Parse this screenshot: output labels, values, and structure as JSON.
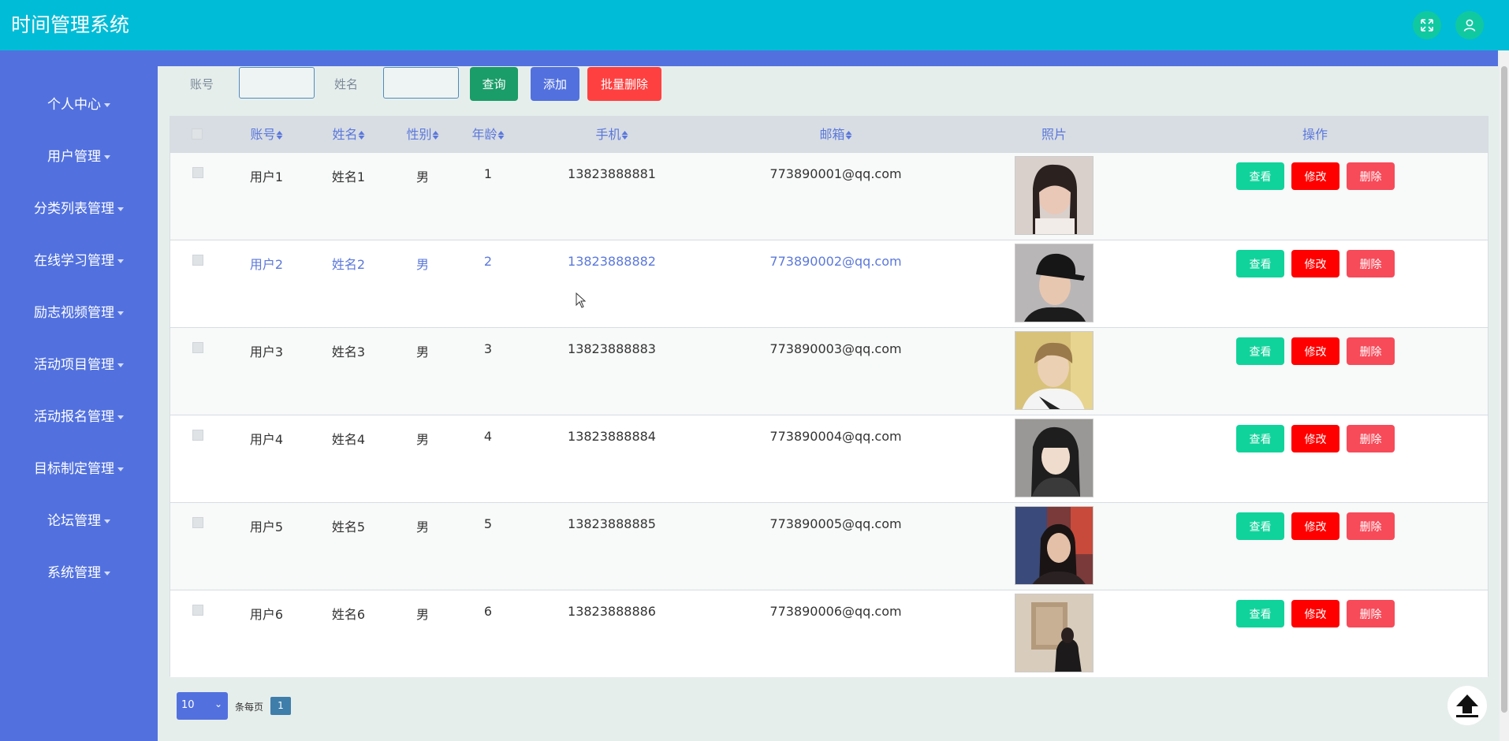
{
  "app": {
    "title": "时间管理系统"
  },
  "header": {
    "icons": [
      "fullscreen-icon",
      "user-icon"
    ]
  },
  "sidebar": {
    "items": [
      {
        "label": "个人中心"
      },
      {
        "label": "用户管理"
      },
      {
        "label": "分类列表管理"
      },
      {
        "label": "在线学习管理"
      },
      {
        "label": "励志视频管理"
      },
      {
        "label": "活动项目管理"
      },
      {
        "label": "活动报名管理"
      },
      {
        "label": "目标制定管理"
      },
      {
        "label": "论坛管理"
      },
      {
        "label": "系统管理"
      }
    ]
  },
  "search": {
    "account_label": "账号",
    "account_value": "",
    "name_label": "姓名",
    "name_value": "",
    "query_button": "查询",
    "add_button": "添加",
    "batch_delete_button": "批量删除"
  },
  "table": {
    "headers": [
      "账号",
      "姓名",
      "性别",
      "年龄",
      "手机",
      "邮箱",
      "照片",
      "操作"
    ],
    "rows": [
      {
        "account": "用户1",
        "name": "姓名1",
        "gender": "男",
        "age": "1",
        "phone": "13823888881",
        "email": "773890001@qq.com"
      },
      {
        "account": "用户2",
        "name": "姓名2",
        "gender": "男",
        "age": "2",
        "phone": "13823888882",
        "email": "773890002@qq.com"
      },
      {
        "account": "用户3",
        "name": "姓名3",
        "gender": "男",
        "age": "3",
        "phone": "13823888883",
        "email": "773890003@qq.com"
      },
      {
        "account": "用户4",
        "name": "姓名4",
        "gender": "男",
        "age": "4",
        "phone": "13823888884",
        "email": "773890004@qq.com"
      },
      {
        "account": "用户5",
        "name": "姓名5",
        "gender": "男",
        "age": "5",
        "phone": "13823888885",
        "email": "773890005@qq.com"
      },
      {
        "account": "用户6",
        "name": "姓名6",
        "gender": "男",
        "age": "6",
        "phone": "13823888886",
        "email": "773890006@qq.com"
      }
    ],
    "actions": {
      "view": "查看",
      "edit": "修改",
      "delete": "删除"
    }
  },
  "pagination": {
    "page_size": "10",
    "per_page_label": "条每页",
    "current_page": "1"
  },
  "colors": {
    "topbar": "#00bcd7",
    "sidebar": "#5271df",
    "view_button": "#10d39b",
    "edit_button": "#ff0000",
    "delete_button": "#f74b5a",
    "query_button": "#1a9d68",
    "batch_delete_button": "#ff4040"
  }
}
